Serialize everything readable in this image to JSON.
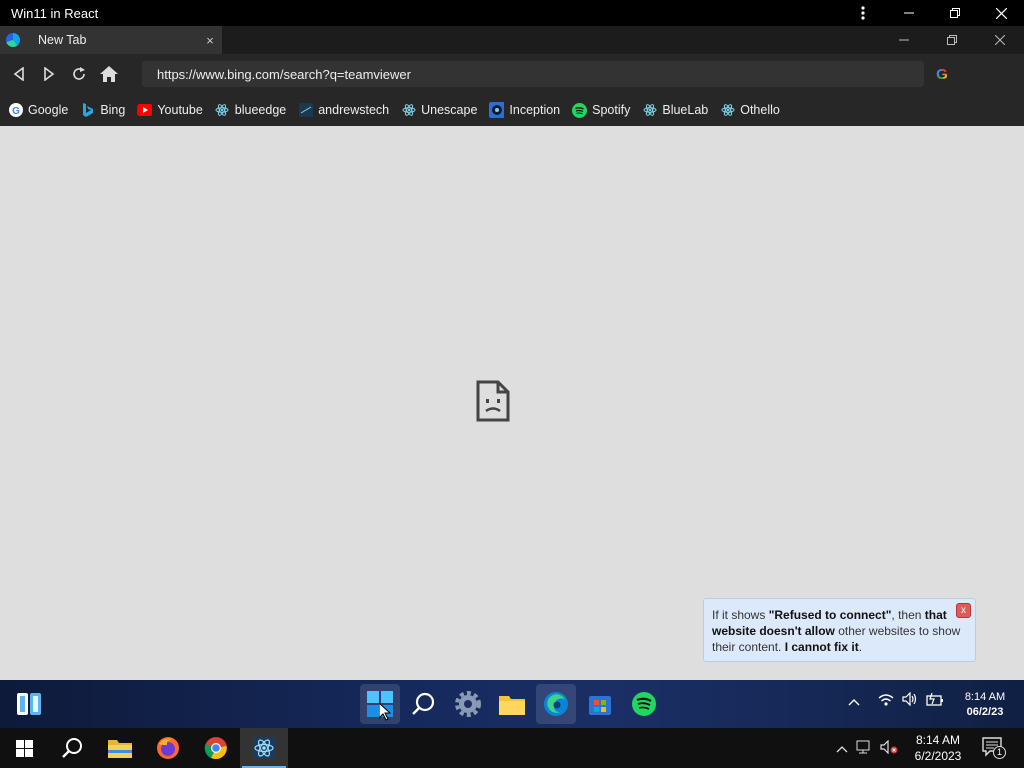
{
  "host": {
    "title": "Win11 in React"
  },
  "browser": {
    "tab_label": "New Tab",
    "tab_close": "×",
    "address": "https://www.bing.com/search?q=teamviewer",
    "google_glyph": "G",
    "bookmarks": [
      {
        "label": "Google",
        "icon": "google-icon"
      },
      {
        "label": "Bing",
        "icon": "bing-icon"
      },
      {
        "label": "Youtube",
        "icon": "youtube-icon"
      },
      {
        "label": "blueedge",
        "icon": "react-icon"
      },
      {
        "label": "andrewstech",
        "icon": "andrewstech-icon"
      },
      {
        "label": "Unescape",
        "icon": "react-icon"
      },
      {
        "label": "Inception",
        "icon": "inception-icon"
      },
      {
        "label": "Spotify",
        "icon": "spotify-icon"
      },
      {
        "label": "BlueLab",
        "icon": "react-icon"
      },
      {
        "label": "Othello",
        "icon": "react-icon"
      }
    ]
  },
  "toast": {
    "p1": "If it shows ",
    "b1": "\"Refused to connect\"",
    "p2": ", then ",
    "b2": "that website doesn't allow",
    "p3": " other websites to show their content. ",
    "b3": "I cannot fix it",
    "p4": ".",
    "close": "x"
  },
  "taskbar11": {
    "time": "8:14 AM",
    "date": "06/2/23"
  },
  "taskbar10": {
    "time": "8:14 AM",
    "date": "6/2/2023",
    "notif_count": "1"
  },
  "colors": {
    "accent": "#0078d4",
    "content_bg": "#dedede",
    "toast_bg": "#dbe9fa"
  }
}
